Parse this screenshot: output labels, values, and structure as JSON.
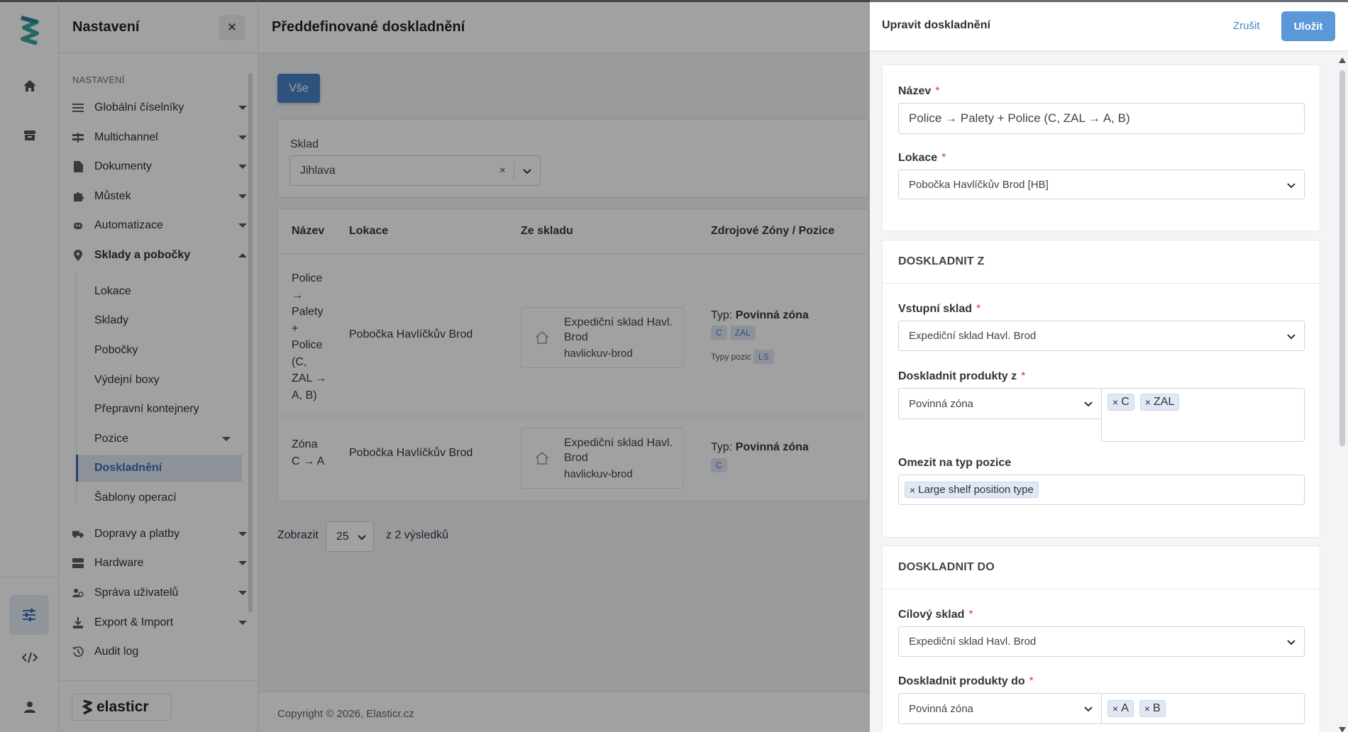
{
  "rail": {
    "icons": [
      "logo-icon",
      "home-icon",
      "warehouse-icon",
      "settings-sliders-icon",
      "code-icon",
      "user-icon"
    ]
  },
  "sidebar": {
    "title": "Nastavení",
    "section": "NASTAVENÍ",
    "items": [
      {
        "label": "Globální číselníky",
        "icon": "sliders-icon"
      },
      {
        "label": "Multichannel",
        "icon": "channels-icon"
      },
      {
        "label": "Dokumenty",
        "icon": "document-icon"
      },
      {
        "label": "Můstek",
        "icon": "puzzle-icon"
      },
      {
        "label": "Automatizace",
        "icon": "robot-icon"
      },
      {
        "label": "Sklady a pobočky",
        "icon": "location-pin-icon"
      }
    ],
    "subitems": [
      "Lokace",
      "Sklady",
      "Pobočky",
      "Výdejní boxy",
      "Přepravní kontejnery",
      "Pozice",
      "Doskladnění",
      "Šablony operací"
    ],
    "items2": [
      {
        "label": "Dopravy a platby",
        "icon": "truck-icon"
      },
      {
        "label": "Hardware",
        "icon": "server-icon"
      },
      {
        "label": "Správa uživatelů",
        "icon": "users-icon"
      },
      {
        "label": "Export & Import",
        "icon": "download-icon"
      },
      {
        "label": "Audit log",
        "icon": "history-icon"
      }
    ],
    "brand": "elasticr"
  },
  "main": {
    "title": "Předdefinované doskladnění",
    "all_button": "Vše",
    "filter": {
      "label": "Sklad",
      "value": "Jihlava"
    },
    "table": {
      "headers": [
        "Název",
        "Lokace",
        "Ze skladu",
        "Zdrojové Zóny / Pozice"
      ],
      "rows": [
        {
          "name": "Police → Palety + Police (C, ZAL → A, B)",
          "location": "Pobočka Havlíčkův Brod",
          "wh_name": "Expediční sklad Havl. Brod",
          "wh_code": "havlickuv-brod",
          "type_label": "Typ:",
          "type_value": "Povinná zóna",
          "zones": [
            "C",
            "ZAL"
          ],
          "pos_label": "Typy pozic",
          "pos_tags": [
            "LS"
          ]
        },
        {
          "name": "Zóna C → A",
          "location": "Pobočka Havlíčkův Brod",
          "wh_name": "Expediční sklad Havl. Brod",
          "wh_code": "havlickuv-brod",
          "type_label": "Typ:",
          "type_value": "Povinná zóna",
          "zones": [
            "C"
          ]
        }
      ]
    },
    "pager": {
      "show": "Zobrazit",
      "size": "25",
      "total": "z 2 výsledků"
    },
    "copyright": "Copyright © 2026, Elasticr.cz"
  },
  "panel": {
    "title": "Upravit doskladnění",
    "cancel": "Zrušit",
    "save": "Uložit",
    "name_label": "Název",
    "name_value": "Police → Palety + Police (C, ZAL → A, B)",
    "location_label": "Lokace",
    "location_value": "Pobočka Havlíčkův Brod [HB]",
    "from_section": "DOSKLADNIT Z",
    "input_wh_label": "Vstupní sklad",
    "input_wh_value": "Expediční sklad Havl. Brod",
    "from_products_label": "Doskladnit produkty z",
    "from_mode": "Povinná zóna",
    "from_zones": [
      "C",
      "ZAL"
    ],
    "limit_label": "Omezit na typ pozice",
    "limit_chips": [
      "Large shelf position type"
    ],
    "to_section": "DOSKLADNIT DO",
    "target_wh_label": "Cílový sklad",
    "target_wh_value": "Expediční sklad Havl. Brod",
    "to_products_label": "Doskladnit produkty do",
    "to_mode": "Povinná zóna",
    "to_zones": [
      "A",
      "B"
    ],
    "required_mark": "*",
    "chip_x": "×"
  }
}
